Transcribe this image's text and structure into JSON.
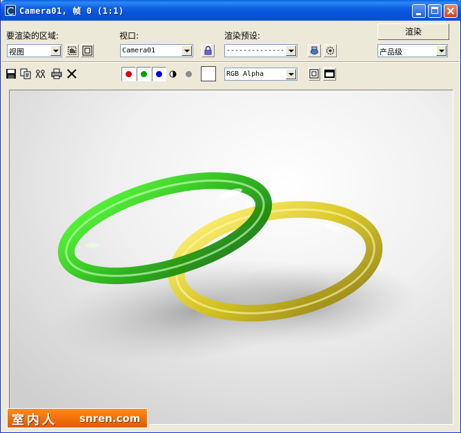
{
  "window": {
    "title": "Camera01, 帧 0 (1:1)"
  },
  "controls": {
    "area_label": "要渲染的区域:",
    "area_value": "视图",
    "viewport_label": "视口:",
    "viewport_value": "Camera01",
    "preset_label": "渲染预设:",
    "preset_value": "---------------",
    "render_button": "渲染",
    "quality_value": "产品级"
  },
  "toolbar": {
    "channel_value": "RGB Alpha",
    "icons": [
      "save-icon",
      "copy-icon",
      "clone-icon",
      "print-icon",
      "clear-icon"
    ],
    "channels": [
      {
        "name": "red",
        "color": "#e00000"
      },
      {
        "name": "green",
        "color": "#00a000"
      },
      {
        "name": "blue",
        "color": "#0000e0"
      }
    ],
    "swatch_color": "#ffffff"
  },
  "render": {
    "ring_colors": {
      "green": "#22c40a",
      "yellow": "#d6c40c"
    }
  },
  "watermark": {
    "chinese": "室内人",
    "site": "snren.com"
  }
}
